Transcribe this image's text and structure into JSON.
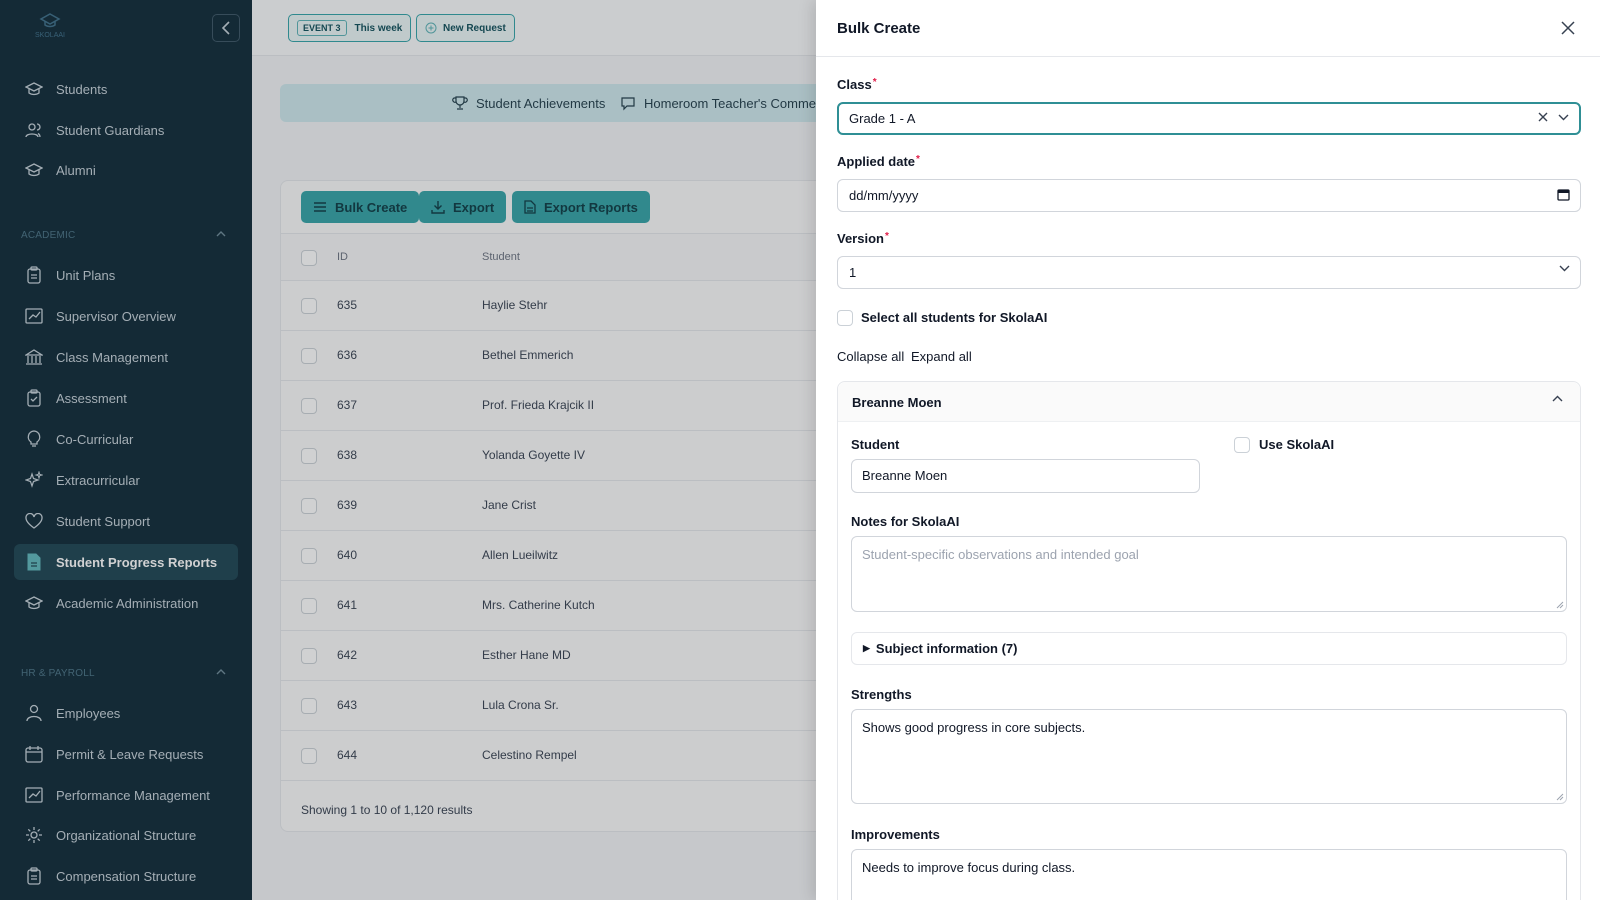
{
  "sidebar": {
    "logo_text": "SKOLAAI",
    "items_top": [
      {
        "label": "Students",
        "icon": "graduation-cap-icon"
      },
      {
        "label": "Student Guardians",
        "icon": "users-icon"
      },
      {
        "label": "Alumni",
        "icon": "graduation-cap-icon"
      }
    ],
    "section_academic": "ACADEMIC",
    "items_academic": [
      {
        "label": "Unit Plans",
        "icon": "clipboard-icon"
      },
      {
        "label": "Supervisor Overview",
        "icon": "chart-icon"
      },
      {
        "label": "Class Management",
        "icon": "building-icon"
      },
      {
        "label": "Assessment",
        "icon": "clipboard-check-icon"
      },
      {
        "label": "Co-Curricular",
        "icon": "lightbulb-icon"
      },
      {
        "label": "Extracurricular",
        "icon": "sparkles-icon"
      },
      {
        "label": "Student Support",
        "icon": "heart-icon"
      },
      {
        "label": "Student Progress Reports",
        "icon": "document-icon",
        "active": true
      },
      {
        "label": "Academic Administration",
        "icon": "graduation-cap-icon"
      }
    ],
    "section_hr": "HR & PAYROLL",
    "items_hr": [
      {
        "label": "Employees",
        "icon": "user-icon"
      },
      {
        "label": "Permit & Leave Requests",
        "icon": "calendar-icon"
      },
      {
        "label": "Performance Management",
        "icon": "chart-icon"
      },
      {
        "label": "Organizational Structure",
        "icon": "gear-icon"
      },
      {
        "label": "Compensation Structure",
        "icon": "clipboard-icon"
      }
    ]
  },
  "topbar": {
    "event_pill": "EVENT 3",
    "event_label": "This week",
    "new_request": "New Request"
  },
  "tabs": {
    "achievements": "Student Achievements",
    "homeroom": "Homeroom Teacher's Comments"
  },
  "toolbar": {
    "bulk_create": "Bulk Create",
    "export": "Export",
    "export_reports": "Export Reports"
  },
  "table": {
    "col_id": "ID",
    "col_student": "Student",
    "rows": [
      {
        "id": "635",
        "name": "Haylie Stehr"
      },
      {
        "id": "636",
        "name": "Bethel Emmerich"
      },
      {
        "id": "637",
        "name": "Prof. Frieda Krajcik II"
      },
      {
        "id": "638",
        "name": "Yolanda Goyette IV"
      },
      {
        "id": "639",
        "name": "Jane Crist"
      },
      {
        "id": "640",
        "name": "Allen Lueilwitz"
      },
      {
        "id": "641",
        "name": "Mrs. Catherine Kutch"
      },
      {
        "id": "642",
        "name": "Esther Hane MD"
      },
      {
        "id": "643",
        "name": "Lula Crona Sr."
      },
      {
        "id": "644",
        "name": "Celestino Rempel"
      }
    ],
    "footer": "Showing 1 to 10 of 1,120 results"
  },
  "panel": {
    "title": "Bulk Create",
    "class_label": "Class",
    "class_value": "Grade 1 - A",
    "date_label": "Applied date",
    "date_placeholder": "dd/mm/yyyy",
    "version_label": "Version",
    "version_value": "1",
    "select_all_label": "Select all students for SkolaAI",
    "collapse_all": "Collapse all",
    "expand_all": "Expand all",
    "student_card": {
      "name": "Breanne Moen",
      "student_label": "Student",
      "student_value": "Breanne Moen",
      "use_ai_label": "Use SkolaAI",
      "notes_label": "Notes for SkolaAI",
      "notes_placeholder": "Student-specific observations and intended goal",
      "subject_info": "Subject information (7)",
      "strengths_label": "Strengths",
      "strengths_value": "Shows good progress in core subjects.",
      "improvements_label": "Improvements",
      "improvements_value": "Needs to improve focus during class."
    }
  },
  "colors": {
    "sidebar_bg": "#0f2a38",
    "accent": "#34a3a7",
    "focus": "#2f8f95",
    "required": "#e11d48"
  }
}
